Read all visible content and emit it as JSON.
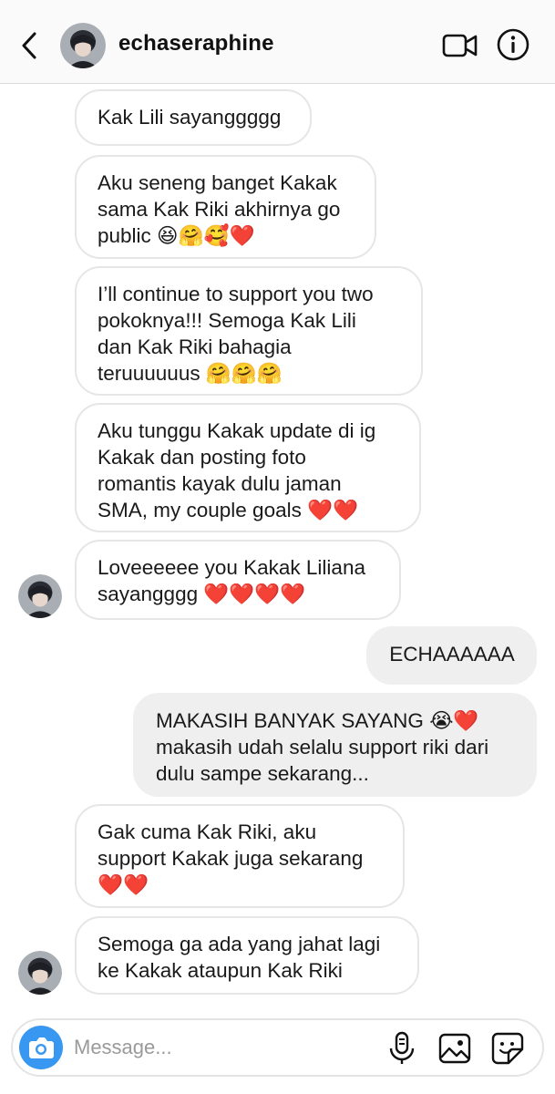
{
  "header": {
    "username": "echaseraphine",
    "back_icon": "chevron-left-icon",
    "video_icon": "video-camera-icon",
    "info_icon": "info-icon"
  },
  "messages": [
    {
      "from": "them",
      "text": "Kak Lili sayanggggg"
    },
    {
      "from": "them",
      "text": "Aku seneng banget Kakak\nsama Kak Riki akhirnya go\npublic 😆🤗🥰❤️"
    },
    {
      "from": "them",
      "text": "I’ll continue to support you two\npokoknya!!! Semoga Kak Lili\ndan Kak Riki bahagia\nteruuuuuus 🤗🤗🤗"
    },
    {
      "from": "them",
      "text": "Aku tunggu Kakak update di ig\nKakak dan posting  foto\nromantis kayak dulu jaman\nSMA, my couple goals ❤️❤️"
    },
    {
      "from": "them",
      "text": "Loveeeeee you Kakak Liliana\nsayangggg ❤️❤️❤️❤️"
    },
    {
      "from": "me",
      "text": "ECHAAAAAA"
    },
    {
      "from": "me",
      "text": "MAKASIH BANYAK SAYANG 😭❤️\nmakasih udah selalu support riki dari\ndulu sampe sekarang..."
    },
    {
      "from": "them",
      "text": "Gak cuma Kak Riki, aku\nsupport Kakak juga sekarang\n❤️❤️"
    },
    {
      "from": "them",
      "text": "Semoga ga ada yang jahat lagi\nke Kakak ataupun Kak Riki"
    }
  ],
  "composer": {
    "placeholder": "Message...",
    "camera_icon": "camera-icon",
    "mic_icon": "microphone-icon",
    "gallery_icon": "image-gallery-icon",
    "sticker_icon": "sticker-icon"
  },
  "colors": {
    "header_bg": "#fafafa",
    "incoming_border": "#e6e6e6",
    "outgoing_bg": "#efefef",
    "camera_button": "#3897f0"
  }
}
